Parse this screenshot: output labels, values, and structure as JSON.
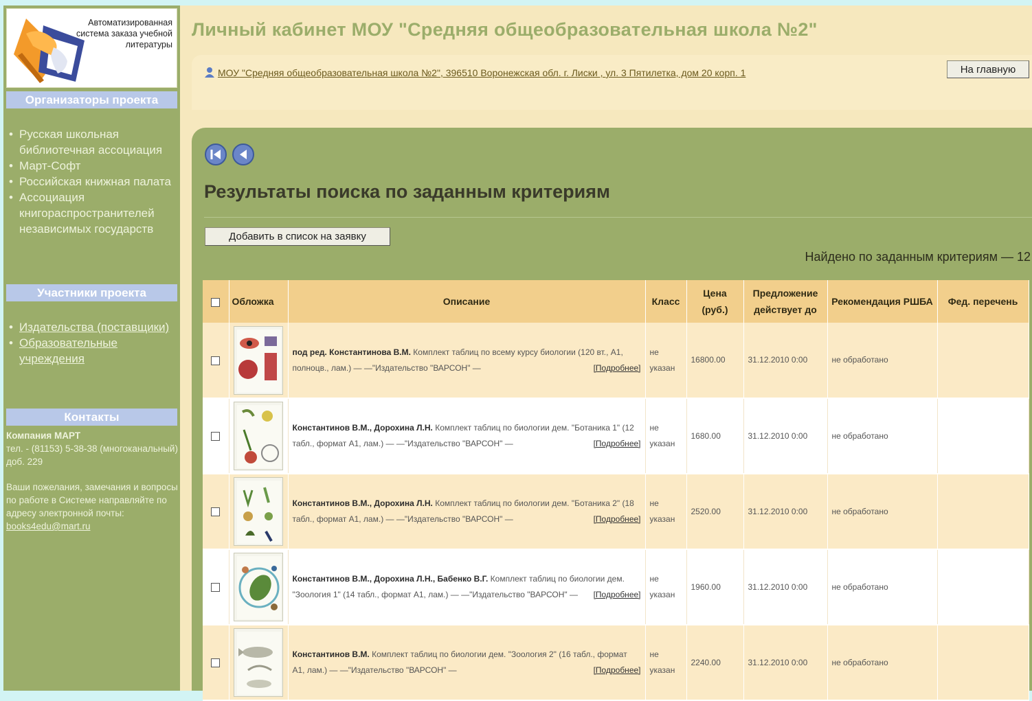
{
  "sidebar": {
    "logo_text": "Автоматизированная система заказа учебной литературы",
    "organizers": {
      "heading": "Организаторы проекта",
      "items": [
        "Русская школьная библиотечная ассоциация",
        "Март-Софт",
        "Российская книжная палата",
        "Ассоциация книгораспространителей независимых государств"
      ]
    },
    "participants": {
      "heading": "Участники проекта",
      "items": [
        "Издательства (поставщики)",
        "Образовательные учреждения"
      ]
    },
    "contacts": {
      "heading": "Контакты",
      "company": "Компания МАРТ",
      "phone": "тел. - (81153) 5-38-38 (многоканальный) доб. 229",
      "note": "Ваши пожелания, замечания и вопросы по работе в Системе направляйте по адресу электронной почты:",
      "email": "books4edu@mart.ru"
    }
  },
  "header": {
    "title": "Личный кабинет МОУ \"Средняя общеобразовательная школа №2\"",
    "address": "МОУ \"Средняя общеобразовательная школа №2\", 396510 Воронежская обл. г. Лиски , ул. 3 Пятилетка, дом 20 корп. 1",
    "home_button": "На главную"
  },
  "results": {
    "title": "Результаты поиска по заданным критериям",
    "add_button": "Добавить в список на заявку",
    "found_text": "Найдено по заданным критериям — 12",
    "columns": {
      "cover": "Обложка",
      "description": "Описание",
      "grade": "Класс",
      "price": "Цена (руб.)",
      "offer": "Предложение действует до",
      "recommendation": "Рекомендация РШБА",
      "federal": "Фед. перечень"
    },
    "rows": [
      {
        "authors": "под ред. Константинова В.М.",
        "text": "Комплект таблиц по всему курсу биологии (120 вт., А1, полноцв., лам.) — —\"Издательство \"ВАРСОН\" —",
        "more": "[Подробнее]",
        "grade": "не указан",
        "price": "16800.00",
        "offer": "31.12.2010 0:00",
        "recommendation": "не обработано",
        "federal": ""
      },
      {
        "authors": "Константинов В.М., Дорохина Л.Н.",
        "text": "Комплект таблиц по биологии дем. \"Ботаника 1\" (12 табл., формат А1, лам.) — —\"Издательство \"ВАРСОН\" —",
        "more": "[Подробнее]",
        "grade": "не указан",
        "price": "1680.00",
        "offer": "31.12.2010 0:00",
        "recommendation": "не обработано",
        "federal": ""
      },
      {
        "authors": "Константинов В.М., Дорохина Л.Н.",
        "text": "Комплект таблиц по биологии дем. \"Ботаника 2\" (18 табл., формат А1, лам.) — —\"Издательство \"ВАРСОН\" —",
        "more": "[Подробнее]",
        "grade": "не указан",
        "price": "2520.00",
        "offer": "31.12.2010 0:00",
        "recommendation": "не обработано",
        "federal": ""
      },
      {
        "authors": "Константинов В.М., Дорохина Л.Н., Бабенко В.Г.",
        "text": "Комплект таблиц по биологии дем. \"Зоология 1\" (14 табл., формат А1, лам.) — —\"Издательство \"ВАРСОН\" —",
        "more": "[Подробнее]",
        "grade": "не указан",
        "price": "1960.00",
        "offer": "31.12.2010 0:00",
        "recommendation": "не обработано",
        "federal": ""
      },
      {
        "authors": "Константинов В.М.",
        "text": "Комплект таблиц по биологии дем. \"Зоология 2\" (16 табл., формат А1, лам.) — —\"Издательство \"ВАРСОН\" —",
        "more": "[Подробнее]",
        "grade": "не указан",
        "price": "2240.00",
        "offer": "31.12.2010 0:00",
        "recommendation": "не обработано",
        "federal": ""
      }
    ]
  },
  "colors": {
    "sidebar_bg": "#9bad6a",
    "page_bg": "#f6e8be",
    "table_header": "#f2cf8c",
    "title_green": "#9bad6a",
    "outer_bg": "#d2f4f4"
  }
}
